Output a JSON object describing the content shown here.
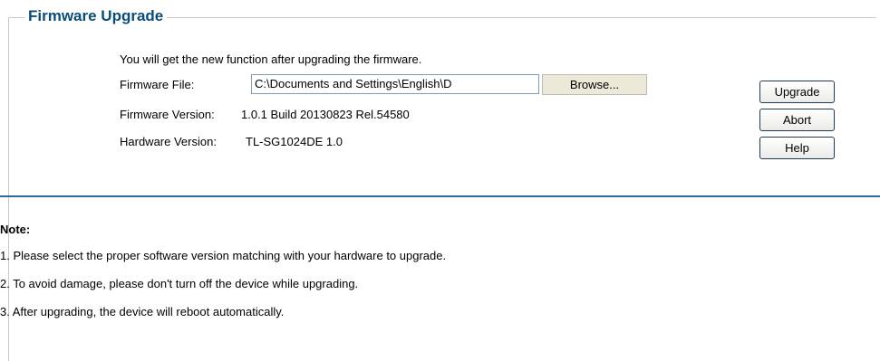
{
  "section": {
    "title": "Firmware Upgrade",
    "intro": "You will get the new function after upgrading the firmware."
  },
  "form": {
    "file_label": "Firmware File:",
    "file_value": "C:\\Documents and Settings\\English\\D",
    "browse_label": "Browse...",
    "fw_version_label": "Firmware Version:",
    "fw_version_value": "1.0.1 Build 20130823 Rel.54580",
    "hw_version_label": "Hardware Version:",
    "hw_version_value": "TL-SG1024DE 1.0"
  },
  "actions": {
    "upgrade_label": "Upgrade",
    "abort_label": "Abort",
    "help_label": "Help"
  },
  "note": {
    "title": "Note:",
    "items": [
      "1. Please select the proper software version matching with your hardware to upgrade.",
      "2. To avoid damage, please don't turn off the device while upgrading.",
      "3. After upgrading, the device will reboot automatically."
    ]
  },
  "colors": {
    "title": "#0a4c7a",
    "divider": "#2e6b94",
    "button_border": "#1f3a57",
    "browse_bg": "#ece9d8"
  }
}
